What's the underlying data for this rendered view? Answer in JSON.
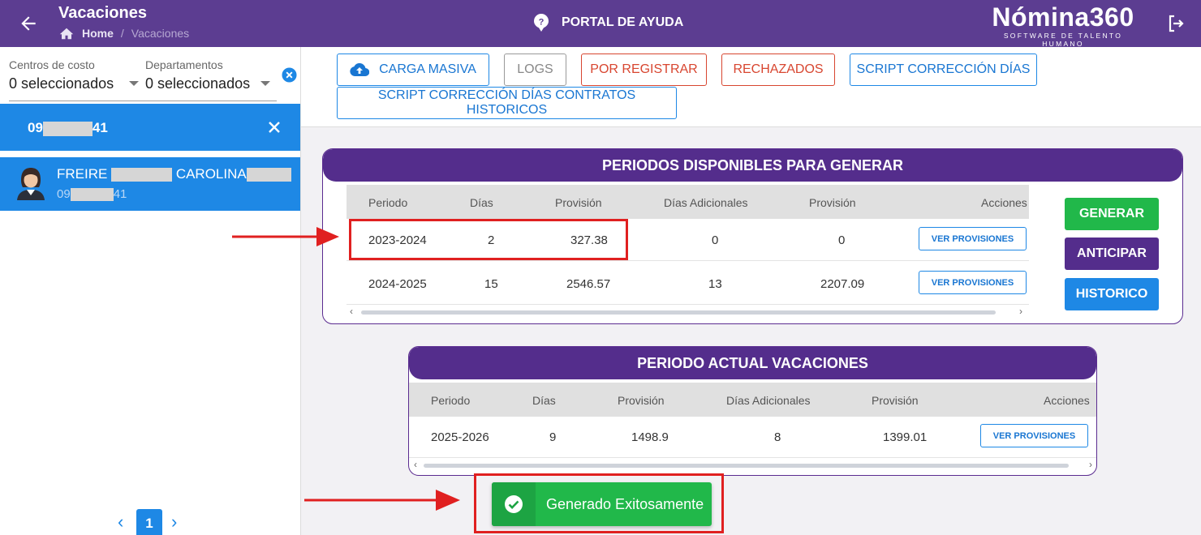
{
  "header": {
    "title": "Vacaciones",
    "breadcrumb_home": "Home",
    "breadcrumb_sep": "/",
    "breadcrumb_current": "Vacaciones",
    "help_label": "PORTAL DE AYUDA",
    "brand_name": "Nómina360",
    "brand_tagline": "SOFTWARE DE TALENTO HUMANO"
  },
  "filters": {
    "cost_centers": {
      "label": "Centros de costo",
      "value": "0 seleccionados"
    },
    "departments": {
      "label": "Departamentos",
      "value": "0 seleccionados"
    }
  },
  "search_chip": {
    "prefix": "09",
    "suffix": "41"
  },
  "employee": {
    "first_name": "FREIRE",
    "second_name": "CAROLINA",
    "id_prefix": "09",
    "id_suffix": "41"
  },
  "pagination": {
    "prev": "‹",
    "current": "1",
    "next": "›"
  },
  "toolbar": {
    "carga_masiva": "CARGA MASIVA",
    "logs": "LOGS",
    "por_registrar": "POR REGISTRAR",
    "rechazados": "RECHAZADOS",
    "script_correccion": "SCRIPT CORRECCIÓN DÍAS",
    "script_historicos": "SCRIPT CORRECCIÓN DÍAS CONTRATOS HISTORICOS"
  },
  "available_periods": {
    "title": "PERIODOS DISPONIBLES PARA GENERAR",
    "columns": [
      "Periodo",
      "Días",
      "Provisión",
      "Días Adicionales",
      "Provisión",
      "Acciones"
    ],
    "rows": [
      {
        "periodo": "2023-2024",
        "dias": "2",
        "provision": "327.38",
        "dias_adicionales": "0",
        "provision_adicional": "0",
        "action": "VER PROVISIONES"
      },
      {
        "periodo": "2024-2025",
        "dias": "15",
        "provision": "2546.57",
        "dias_adicionales": "13",
        "provision_adicional": "2207.09",
        "action": "VER PROVISIONES"
      }
    ]
  },
  "actions": {
    "generar": "GENERAR",
    "anticipar": "ANTICIPAR",
    "historico": "HISTORICO"
  },
  "current_period": {
    "title": "PERIODO ACTUAL VACACIONES",
    "columns": [
      "Periodo",
      "Días",
      "Provisión",
      "Días Adicionales",
      "Provisión",
      "Acciones"
    ],
    "rows": [
      {
        "periodo": "2025-2026",
        "dias": "9",
        "provision": "1498.9",
        "dias_adicionales": "8",
        "provision_adicional": "1399.01",
        "action": "VER PROVISIONES"
      }
    ]
  },
  "scroll_arrows": {
    "left": "‹",
    "right": "›"
  },
  "toast": {
    "message": "Generado Exitosamente"
  },
  "colors": {
    "header_purple": "#5c3d91",
    "card_purple": "#542d8c",
    "primary_blue": "#1e88e5",
    "success_green": "#21b84a",
    "danger_red": "#d84630",
    "annotation_red": "#e02020"
  }
}
